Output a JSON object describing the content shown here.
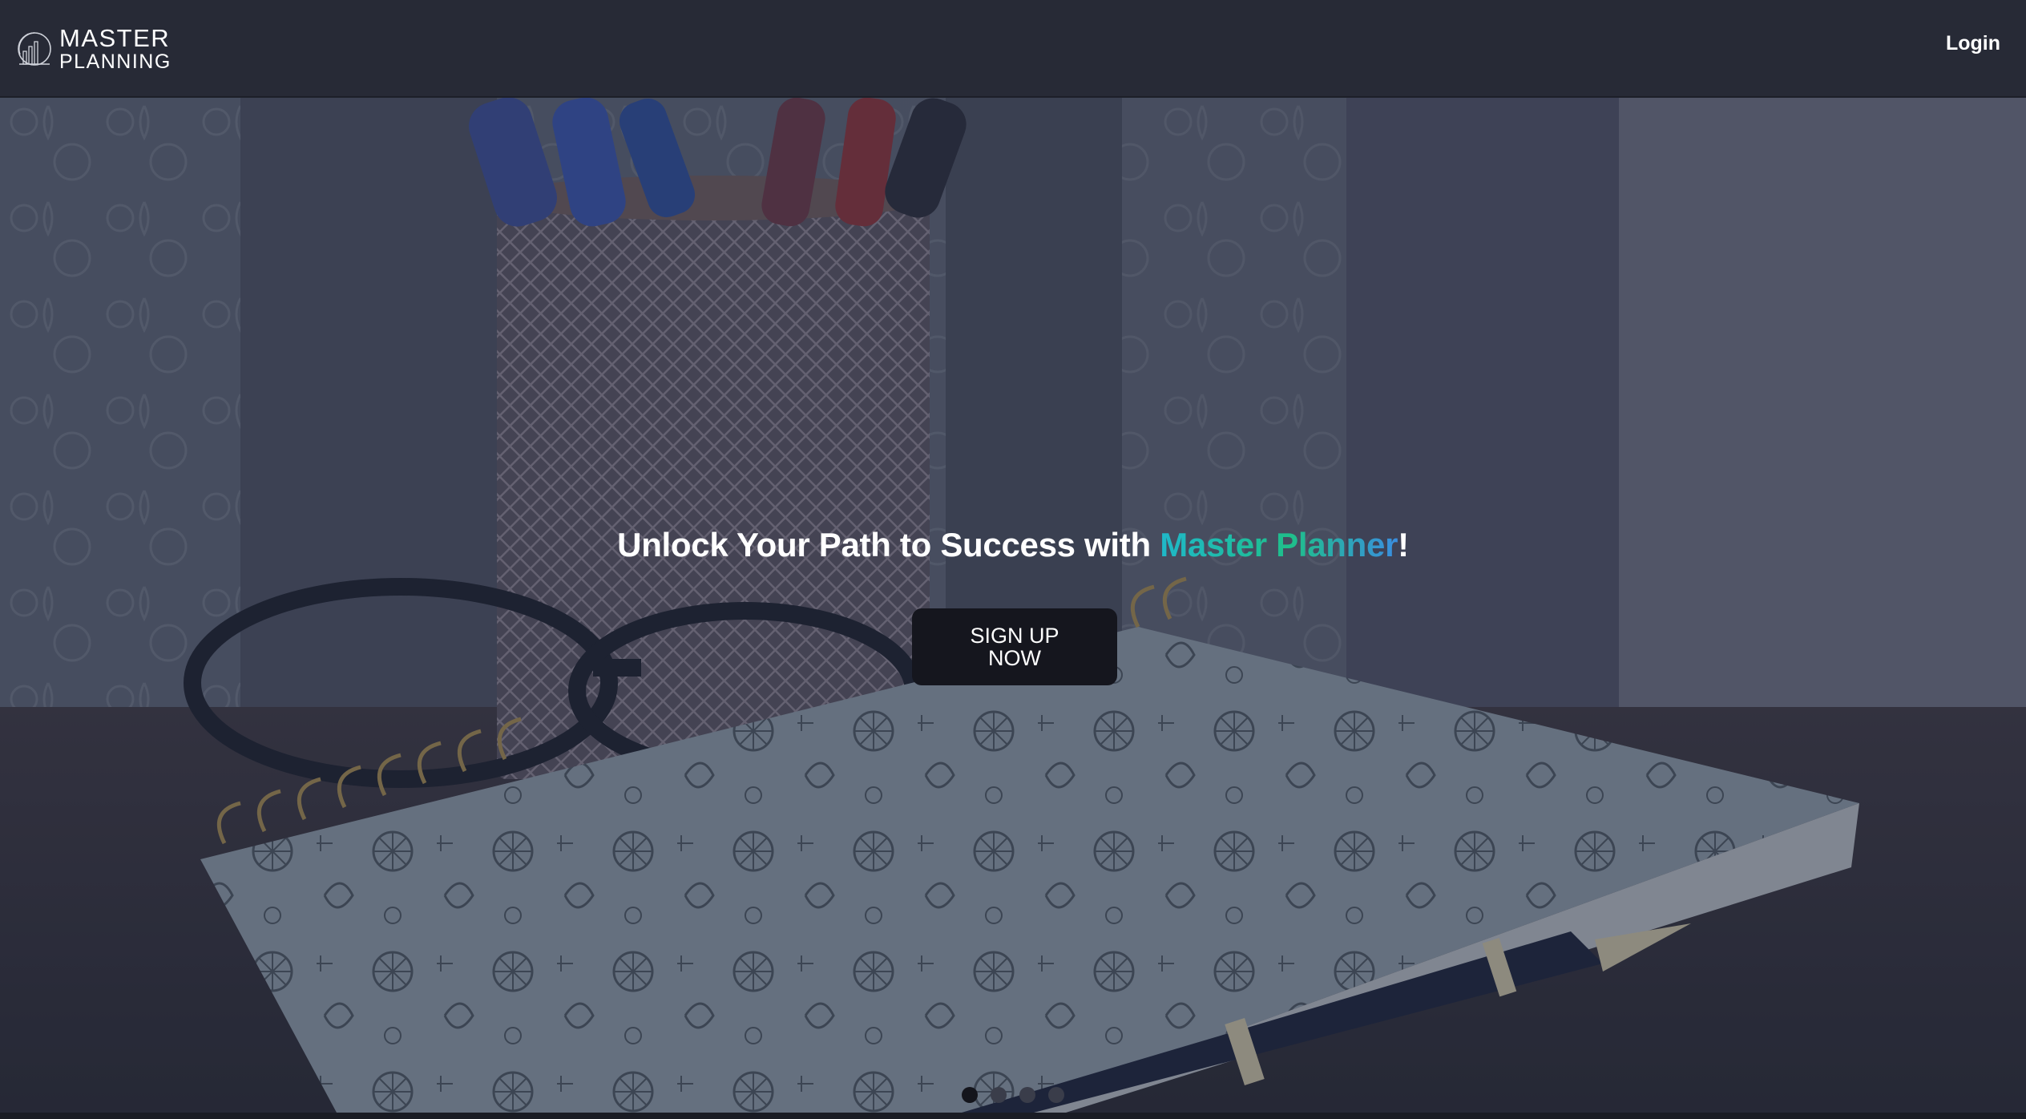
{
  "brand": {
    "line1": "MASTER",
    "line2": "PLANNING"
  },
  "nav": {
    "login_label": "Login"
  },
  "hero": {
    "headline_prefix": "Unlock Your Path to Success with ",
    "headline_brand": "Master Planner",
    "headline_suffix": "!",
    "cta_label": "SIGN UP NOW",
    "slides": [
      {
        "active": true
      },
      {
        "active": false
      },
      {
        "active": false
      },
      {
        "active": false
      }
    ]
  },
  "colors": {
    "navbar": "#272a36",
    "button": "#15161e",
    "brand_gradient_start": "#1fb8c9",
    "brand_gradient_mid": "#1fbf8a",
    "brand_gradient_end": "#3a8ee0"
  }
}
